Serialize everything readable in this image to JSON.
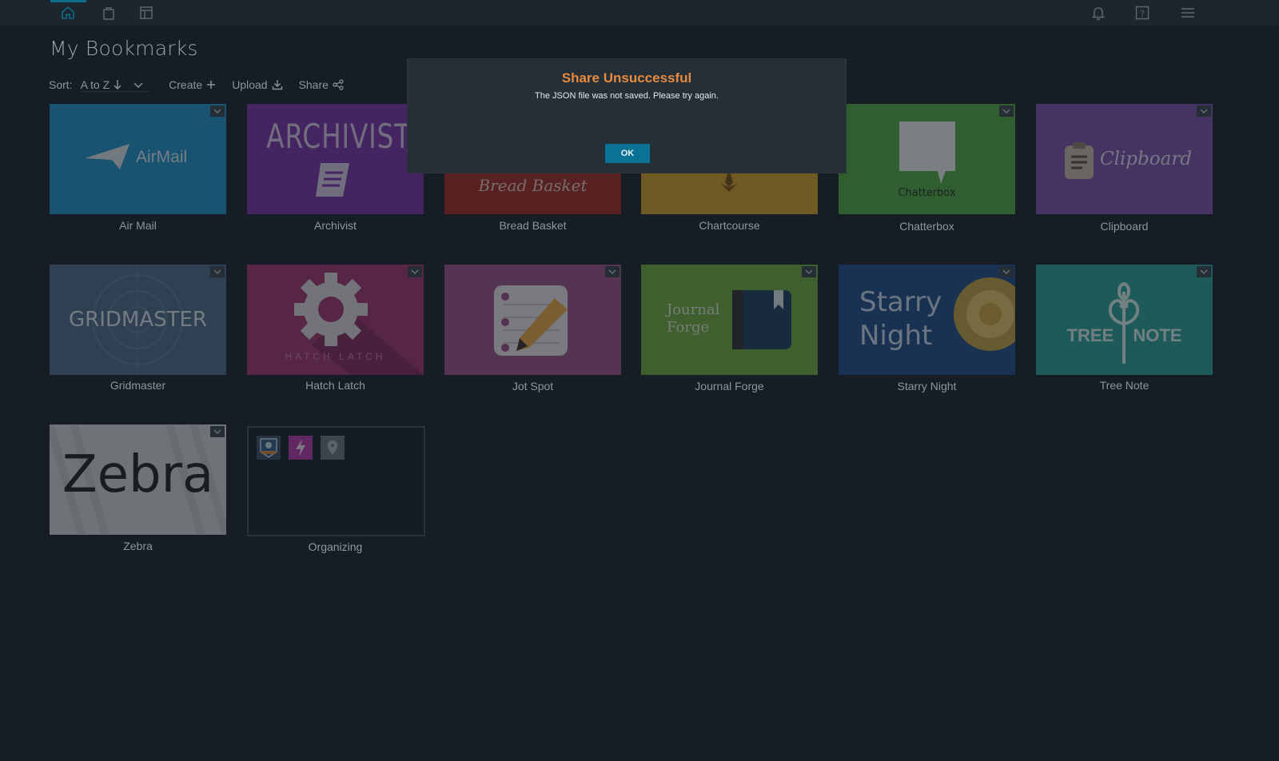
{
  "nav": {
    "icons": [
      "home-icon",
      "bag-icon",
      "layout-icon"
    ],
    "right_icons": [
      "bell-icon",
      "help-icon",
      "hamburger-menu-icon"
    ],
    "accent": "#0e6c8c"
  },
  "page": {
    "title": "My Bookmarks"
  },
  "toolbar": {
    "sort_label": "Sort:",
    "sort_value": "A to Z",
    "create_label": "Create",
    "upload_label": "Upload",
    "share_label": "Share"
  },
  "tiles": [
    {
      "name": "Air Mail",
      "art_text": "AirMail",
      "color": "#1f8fc7"
    },
    {
      "name": "Archivist",
      "art_text": "ARCHIVIST",
      "color": "#7a2ea3"
    },
    {
      "name": "Bread Basket",
      "art_text": "Bread Basket",
      "color": "#a0261e"
    },
    {
      "name": "Chartcourse",
      "art_text": "",
      "color": "#d59b22"
    },
    {
      "name": "Chatterbox",
      "art_text": "Chatterbox",
      "color": "#4fa63d"
    },
    {
      "name": "Clipboard",
      "art_text": "Clipboard",
      "color": "#7a4ea6"
    },
    {
      "name": "Gridmaster",
      "art_text": "GRIDMASTER",
      "color": "#4a6682"
    },
    {
      "name": "Hatch Latch",
      "art_text": "HATCH LATCH",
      "color": "#a0316a"
    },
    {
      "name": "Jot Spot",
      "art_text": "",
      "color": "#9a4d86"
    },
    {
      "name": "Journal Forge",
      "art_text": "Journal Forge",
      "color": "#6fa83a"
    },
    {
      "name": "Starry Night",
      "art_text": "Starry Night",
      "color": "#1e4a86"
    },
    {
      "name": "Tree Note",
      "art_text": "TREE NOTE",
      "color": "#2a9e96"
    },
    {
      "name": "Zebra",
      "art_text": "Zebra",
      "color": "#d2d2d2"
    }
  ],
  "folder": {
    "name": "Organizing"
  },
  "modal": {
    "title": "Share Unsuccessful",
    "message": "The JSON file was not saved. Please try again.",
    "ok_label": "OK"
  }
}
